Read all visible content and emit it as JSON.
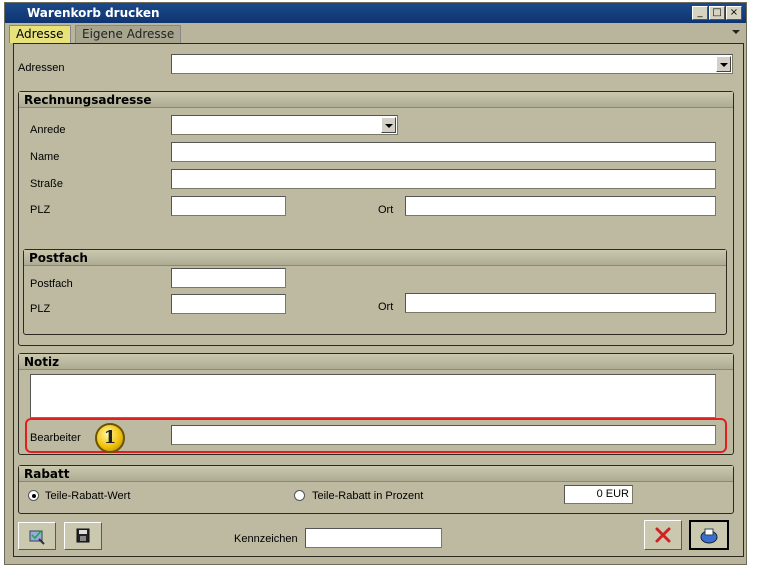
{
  "window": {
    "title": "Warenkorb drucken",
    "minimize": "_",
    "maximize": "□",
    "close": "×"
  },
  "tabs": [
    "Adresse",
    "Eigene Adresse"
  ],
  "adressen": {
    "label": "Adressen",
    "value": ""
  },
  "rechnungsadresse": {
    "header": "Rechnungsadresse",
    "anrede_label": "Anrede",
    "name_label": "Name",
    "strasse_label": "Straße",
    "plz_label": "PLZ",
    "ort_label": "Ort"
  },
  "postfach": {
    "header": "Postfach",
    "postfach_label": "Postfach",
    "plz_label": "PLZ",
    "ort_label": "Ort"
  },
  "notiz": {
    "header": "Notiz",
    "bearbeiter_label": "Bearbeiter",
    "badge": "1"
  },
  "rabatt": {
    "header": "Rabatt",
    "option_wert": "Teile-Rabatt-Wert",
    "option_prozent": "Teile-Rabatt in Prozent",
    "value": "0 EUR"
  },
  "footer": {
    "kennzeichen_label": "Kennzeichen"
  },
  "icons": [
    "print-preview-icon",
    "save-icon",
    "cancel-icon",
    "print-icon"
  ],
  "colors": {
    "titlebar": "#0f3470",
    "active_tab": "#e8e27a",
    "highlight": "#e02020",
    "badge": "#f2c20c"
  }
}
